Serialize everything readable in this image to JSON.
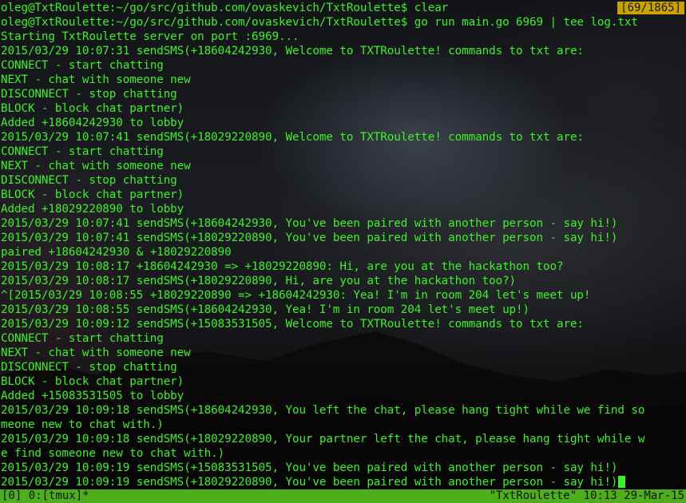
{
  "terminal": {
    "lines": [
      "oleg@TxtRoulette:~/go/src/github.com/ovaskevich/TxtRoulette$ clear",
      "oleg@TxtRoulette:~/go/src/github.com/ovaskevich/TxtRoulette$ go run main.go 6969 | tee log.txt",
      "Starting TxtRoulette server on port :6969...",
      "2015/03/29 10:07:31 sendSMS(+18604242930, Welcome to TXTRoulette! commands to txt are:",
      "CONNECT - start chatting",
      "NEXT - chat with someone new",
      "DISCONNECT - stop chatting",
      "BLOCK - block chat partner)",
      "Added +18604242930 to lobby",
      "2015/03/29 10:07:41 sendSMS(+18029220890, Welcome to TXTRoulette! commands to txt are:",
      "CONNECT - start chatting",
      "NEXT - chat with someone new",
      "DISCONNECT - stop chatting",
      "BLOCK - block chat partner)",
      "Added +18029220890 to lobby",
      "2015/03/29 10:07:41 sendSMS(+18604242930, You've been paired with another person - say hi!)",
      "2015/03/29 10:07:41 sendSMS(+18029220890, You've been paired with another person - say hi!)",
      "paired +18604242930 & +18029220890",
      "2015/03/29 10:08:17 +18604242930 => +18029220890: Hi, are you at the hackathon too?",
      "2015/03/29 10:08:17 sendSMS(+18029220890, Hi, are you at the hackathon too?)",
      "^[2015/03/29 10:08:55 +18029220890 => +18604242930: Yea! I'm in room 204 let's meet up!",
      "2015/03/29 10:08:55 sendSMS(+18604242930, Yea! I'm in room 204 let's meet up!)",
      "2015/03/29 10:09:12 sendSMS(+15083531505, Welcome to TXTRoulette! commands to txt are:",
      "CONNECT - start chatting",
      "NEXT - chat with someone new",
      "DISCONNECT - stop chatting",
      "BLOCK - block chat partner)",
      "Added +15083531505 to lobby",
      "2015/03/29 10:09:18 sendSMS(+18604242930, You left the chat, please hang tight while we find so",
      "meone new to chat with.)",
      "2015/03/29 10:09:18 sendSMS(+18029220890, Your partner left the chat, please hang tight while w",
      "e find someone new to chat with.)",
      "2015/03/29 10:09:19 sendSMS(+15083531505, You've been paired with another person - say hi!)",
      "2015/03/29 10:09:19 sendSMS(+18029220890, You've been paired with another person - say hi!)"
    ],
    "scroll_position": "[69/1865]"
  },
  "statusbar": {
    "left": "[0] 0:[tmux]*",
    "right": "\"TxtRoulette\" 10:13 29-Mar-15"
  },
  "colors": {
    "text": "#3ef02a",
    "statusbar_bg": "#4fae1c",
    "counter_bg": "#caa200"
  }
}
